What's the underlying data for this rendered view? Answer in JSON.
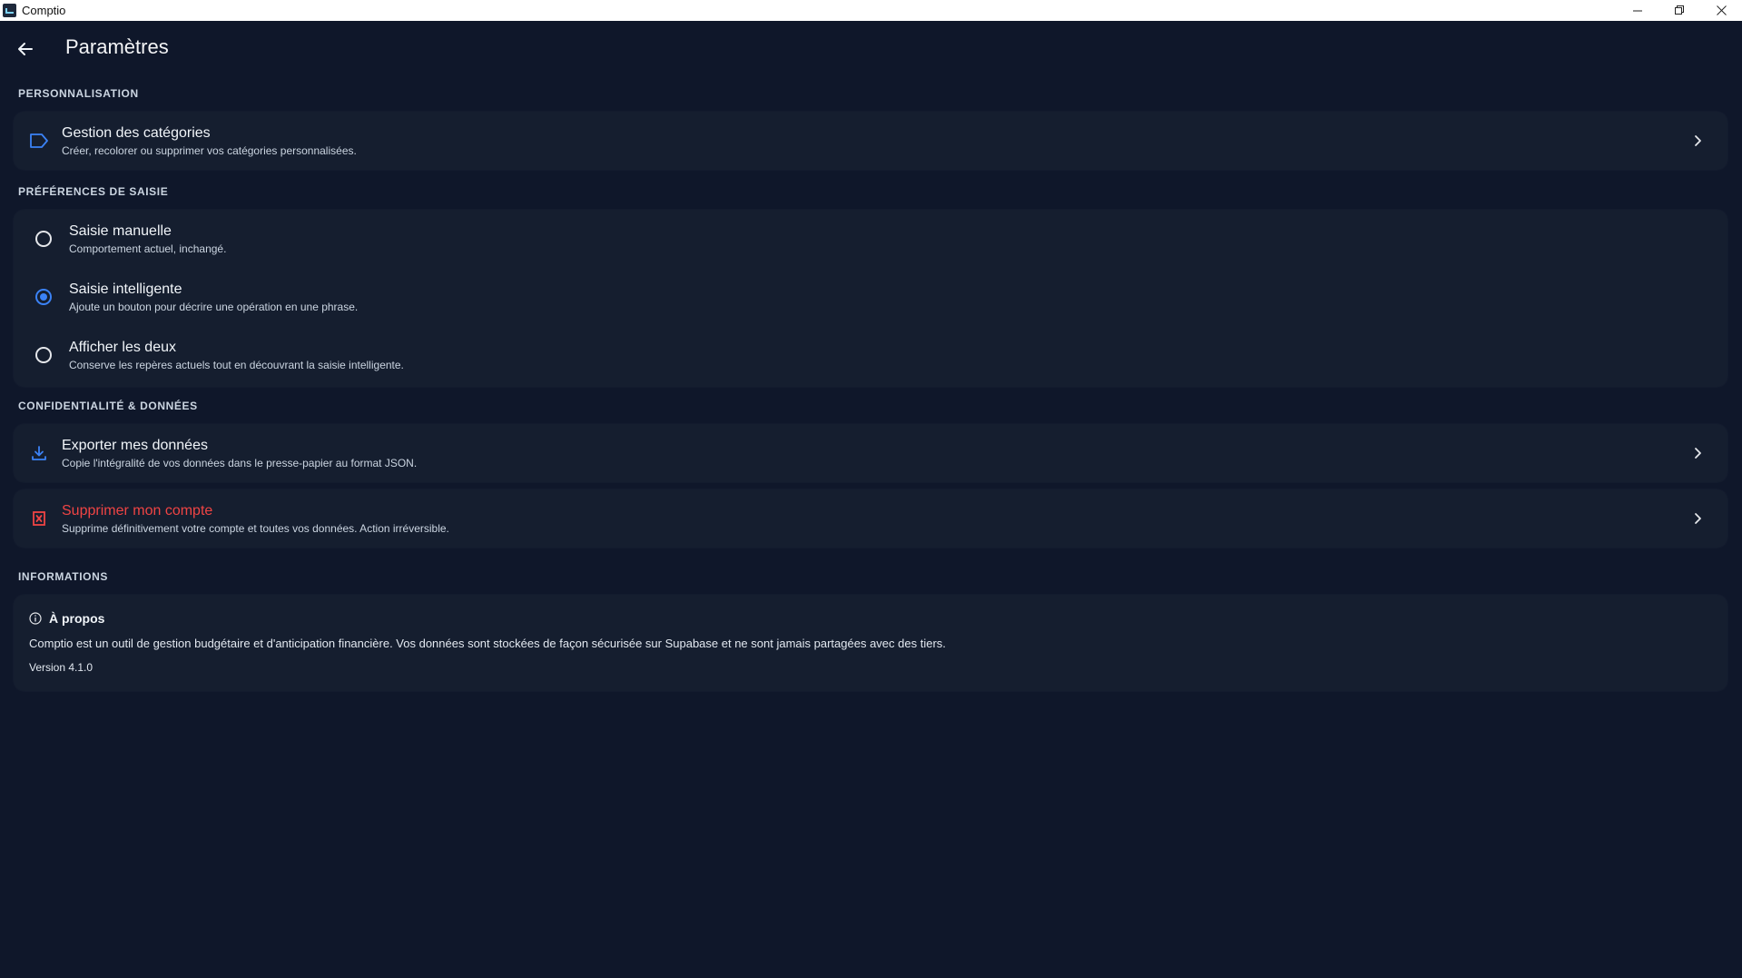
{
  "window": {
    "title": "Comptio",
    "minimize_label": "─",
    "maximize_label": "❐",
    "close_label": "✕"
  },
  "header": {
    "title": "Paramètres"
  },
  "sections": {
    "personalisation": {
      "label": "PERSONNALISATION",
      "categories": {
        "title": "Gestion des catégories",
        "subtitle": "Créer, recolorer ou supprimer vos catégories personnalisées."
      }
    },
    "saisie": {
      "label": "PRÉFÉRENCES DE SAISIE",
      "options": [
        {
          "title": "Saisie manuelle",
          "subtitle": "Comportement actuel, inchangé.",
          "selected": false
        },
        {
          "title": "Saisie intelligente",
          "subtitle": "Ajoute un bouton pour décrire une opération en une phrase.",
          "selected": true
        },
        {
          "title": "Afficher les deux",
          "subtitle": "Conserve les repères actuels tout en découvrant la saisie intelligente.",
          "selected": false
        }
      ]
    },
    "confidentialite": {
      "label": "CONFIDENTIALITÉ & DONNÉES",
      "export": {
        "title": "Exporter mes données",
        "subtitle": "Copie l'intégralité de vos données dans le presse-papier au format JSON."
      },
      "delete": {
        "title": "Supprimer mon compte",
        "subtitle": "Supprime définitivement votre compte et toutes vos données. Action irréversible."
      }
    },
    "informations": {
      "label": "INFORMATIONS",
      "about": {
        "title": "À propos",
        "description": "Comptio est un outil de gestion budgétaire et d'anticipation financière. Vos données sont stockées de façon sécurisée sur Supabase et ne sont jamais partagées avec des tiers.",
        "version": "Version 4.1.0"
      }
    }
  },
  "colors": {
    "background": "#0f172a",
    "card": "#151e2f",
    "accent": "#3b82f6",
    "danger": "#ef4444"
  }
}
